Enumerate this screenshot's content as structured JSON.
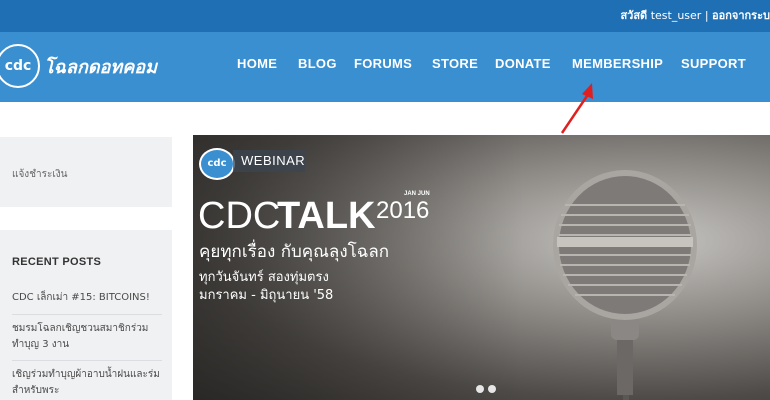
{
  "topbar": {
    "greeting": "สวัสดี",
    "username": "test_user",
    "separator": " | ",
    "logout": "ออกจากระบ"
  },
  "logo": {
    "mark": "cdc",
    "script": "โฉลกดอทคอม"
  },
  "nav": {
    "items": [
      "HOME",
      "BLOG",
      "FORUMS",
      "STORE",
      "DONATE",
      "MEMBERSHIP",
      "SUPPORT"
    ]
  },
  "sidebar": {
    "pay_link": "แจ้งชำระเงิน",
    "recent_posts_title": "RECENT POSTS",
    "posts": [
      "CDC เล็กเม่า #15: BITCOINS!",
      "ชมรมโฉลกเชิญชวนสมาชิกร่วมทำบุญ 3 งาน",
      "เชิญร่วมทำบุญผ้าอาบน้ำฝนและร่มสำหรับพระ"
    ]
  },
  "banner": {
    "logo_mark": "cdc",
    "webinar": "WEBINAR",
    "talk_light": "CDC",
    "talk_bold": "TALK",
    "year": "2016",
    "month_tag": "JAN JUN",
    "subtitle": "คุยทุกเรื่อง กับคุณลุงโฉลก",
    "schedule1": "ทุกวันจันทร์ สองทุ่มตรง",
    "schedule2": "มกราคม - มิถุนายน '58"
  },
  "colors": {
    "topbar": "#1f6fb5",
    "nav": "#3a8fd1",
    "sidebar": "#f0f1f3",
    "arrow": "#e02020"
  }
}
